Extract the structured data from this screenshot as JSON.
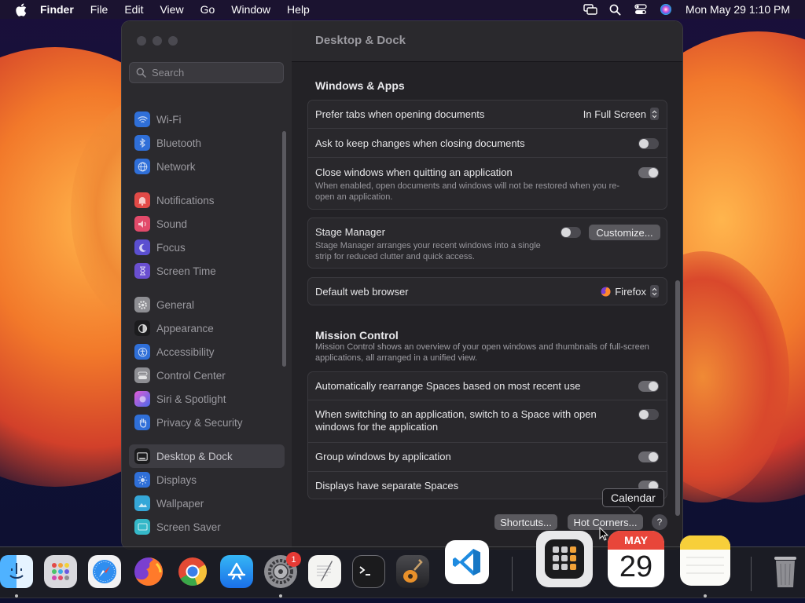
{
  "menubar": {
    "app_name": "Finder",
    "items": [
      "File",
      "Edit",
      "View",
      "Go",
      "Window",
      "Help"
    ],
    "clock": "Mon May 29  1:10 PM",
    "status_icons": [
      "screen-mirroring-icon",
      "search-icon",
      "control-center-icon",
      "siri-icon"
    ]
  },
  "search": {
    "placeholder": "Search"
  },
  "sidebar": {
    "items": [
      {
        "label": "Wi-Fi",
        "icon": "wifi-icon",
        "color": "#2f6fd8"
      },
      {
        "label": "Bluetooth",
        "icon": "bluetooth-icon",
        "color": "#2f6fd8"
      },
      {
        "label": "Network",
        "icon": "globe-icon",
        "color": "#2f6fd8"
      },
      {
        "label": "Notifications",
        "icon": "bell-icon",
        "color": "#e24a47"
      },
      {
        "label": "Sound",
        "icon": "speaker-icon",
        "color": "#e24a6a"
      },
      {
        "label": "Focus",
        "icon": "moon-icon",
        "color": "#5b4fd0"
      },
      {
        "label": "Screen Time",
        "icon": "hourglass-icon",
        "color": "#6a4fd0"
      },
      {
        "label": "General",
        "icon": "gear-icon",
        "color": "#8e8e93"
      },
      {
        "label": "Appearance",
        "icon": "appearance-icon",
        "color": "#1c1c1e"
      },
      {
        "label": "Accessibility",
        "icon": "accessibility-icon",
        "color": "#2f6fd8"
      },
      {
        "label": "Control Center",
        "icon": "control-center-icon",
        "color": "#8e8e93"
      },
      {
        "label": "Siri & Spotlight",
        "icon": "siri-icon",
        "color": "#b04fd0"
      },
      {
        "label": "Privacy & Security",
        "icon": "hand-icon",
        "color": "#2f6fd8"
      },
      {
        "label": "Desktop & Dock",
        "icon": "dock-icon",
        "color": "#1c1c1e"
      },
      {
        "label": "Displays",
        "icon": "sun-icon",
        "color": "#2f6fd8"
      },
      {
        "label": "Wallpaper",
        "icon": "wallpaper-icon",
        "color": "#35a7d8"
      },
      {
        "label": "Screen Saver",
        "icon": "screensaver-icon",
        "color": "#35b8c8"
      }
    ],
    "active": "Desktop & Dock"
  },
  "content": {
    "title": "Desktop & Dock",
    "windows_apps": {
      "title": "Windows & Apps",
      "prefer_tabs": {
        "label": "Prefer tabs when opening documents",
        "value": "In Full Screen"
      },
      "ask_keep": {
        "label": "Ask to keep changes when closing documents",
        "on": false
      },
      "close_windows": {
        "label": "Close windows when quitting an application",
        "desc": "When enabled, open documents and windows will not be restored when you re-open an application.",
        "on": true
      },
      "stage_manager": {
        "label": "Stage Manager",
        "desc": "Stage Manager arranges your recent windows into a single strip for reduced clutter and quick access.",
        "on": false,
        "button": "Customize..."
      },
      "browser": {
        "label": "Default web browser",
        "value": "Firefox"
      }
    },
    "mission_control": {
      "title": "Mission Control",
      "desc": "Mission Control shows an overview of your open windows and thumbnails of full-screen applications, all arranged in a unified view.",
      "rows": [
        {
          "label": "Automatically rearrange Spaces based on most recent use",
          "on": true
        },
        {
          "label": "When switching to an application, switch to a Space with open windows for the application",
          "on": false
        },
        {
          "label": "Group windows by application",
          "on": true
        },
        {
          "label": "Displays have separate Spaces",
          "on": true
        }
      ]
    },
    "buttons": {
      "shortcuts": "Shortcuts...",
      "hot_corners": "Hot Corners...",
      "help": "?"
    }
  },
  "tooltip": "Calendar",
  "dock": {
    "apps": [
      "Finder",
      "Launchpad",
      "Safari",
      "Firefox",
      "Chrome",
      "App Store",
      "System Settings",
      "TextEdit",
      "Terminal",
      "GarageBand",
      "Visual Studio Code",
      "Calculator",
      "Calendar",
      "Notes",
      "Trash"
    ],
    "settings_badge": "1",
    "calendar_month": "MAY",
    "calendar_day": "29"
  }
}
